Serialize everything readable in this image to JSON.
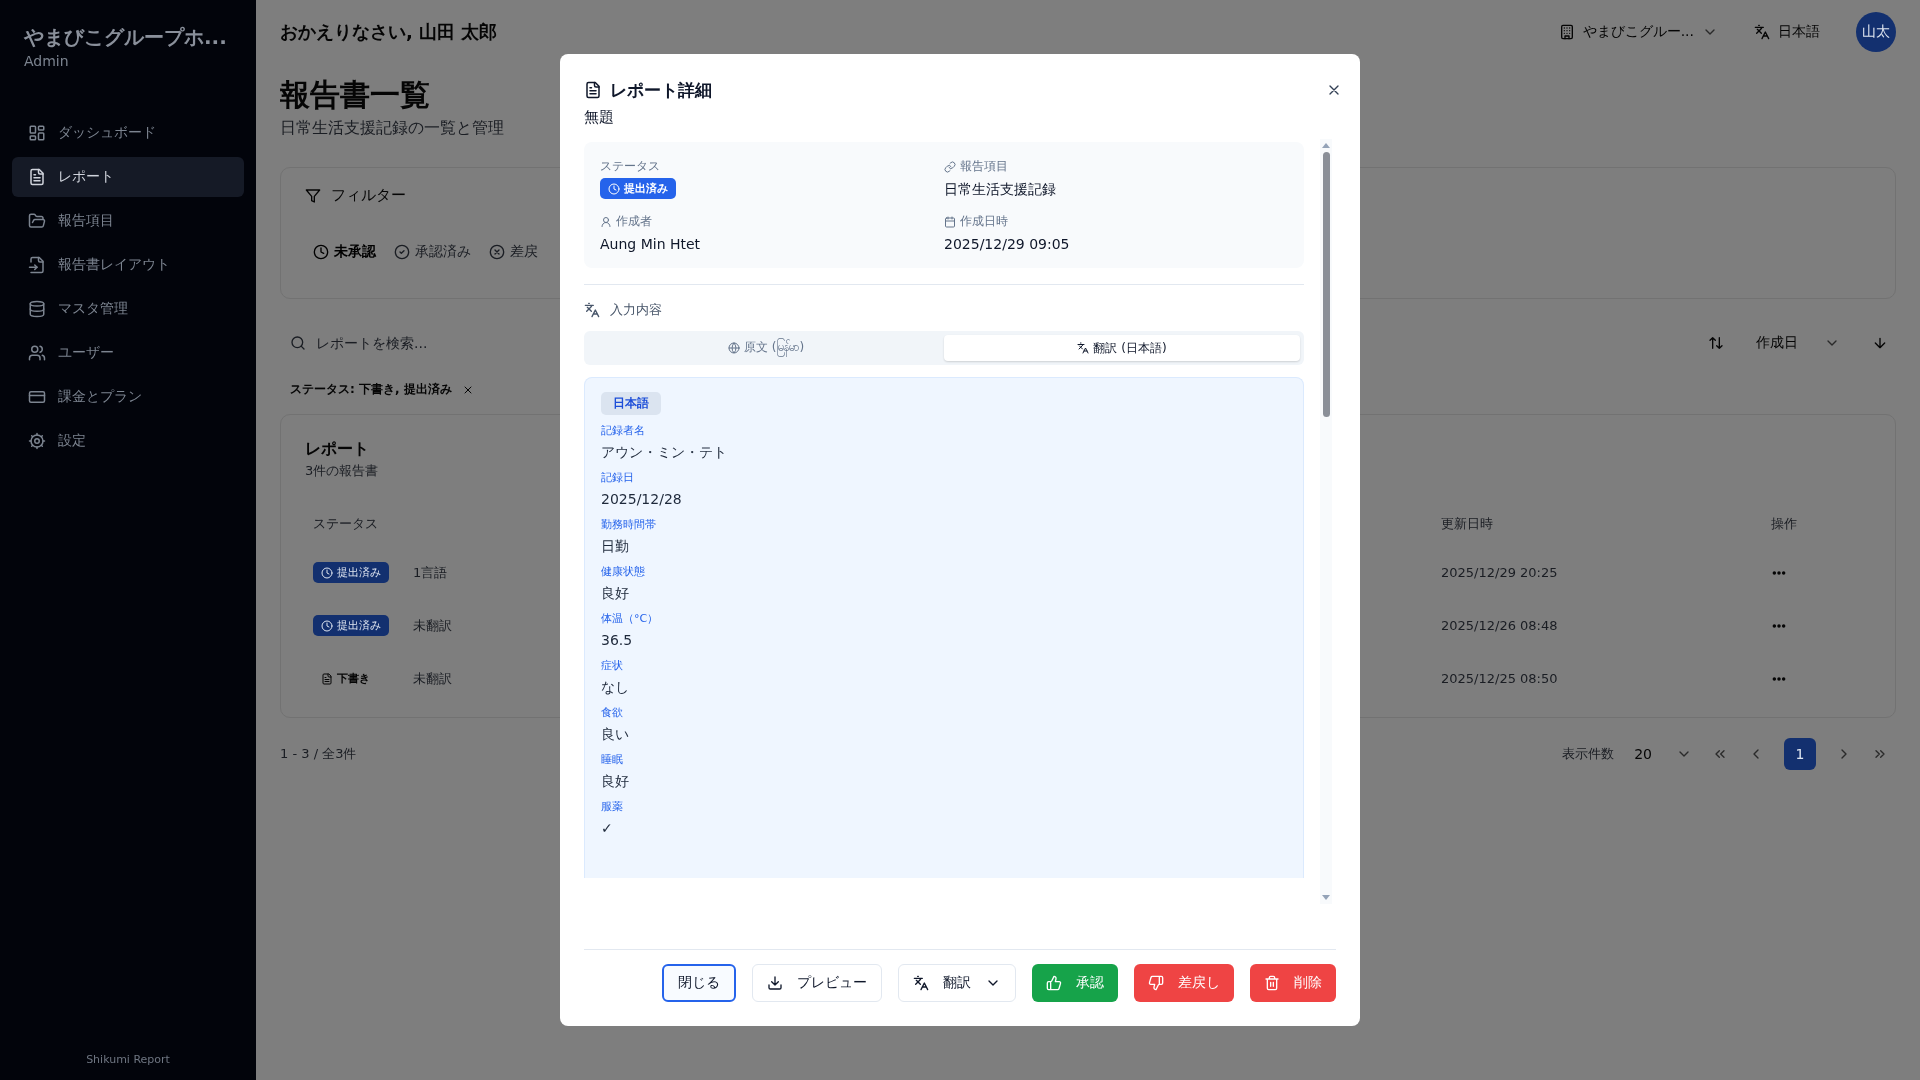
{
  "sidebar": {
    "brand": "やまびこグループホ...",
    "role": "Admin",
    "items": [
      {
        "label": "ダッシュボード",
        "selected": false
      },
      {
        "label": "レポート",
        "selected": true
      },
      {
        "label": "報告項目",
        "selected": false
      },
      {
        "label": "報告書レイアウト",
        "selected": false
      },
      {
        "label": "マスタ管理",
        "selected": false
      },
      {
        "label": "ユーザー",
        "selected": false
      },
      {
        "label": "課金とプラン",
        "selected": false
      },
      {
        "label": "設定",
        "selected": false
      }
    ],
    "footer": "Shikumi Report"
  },
  "header": {
    "greeting": "おかえりなさい, 山田 太郎",
    "organization": "やまびこグルー...",
    "language": "日本語",
    "avatar": "山太"
  },
  "page": {
    "title": "報告書一覧",
    "subtitle": "日常生活支援記録の一覧と管理"
  },
  "filter": {
    "title": "フィルター",
    "tabs": [
      {
        "label": "未承認",
        "selected": true
      },
      {
        "label": "承認済み",
        "selected": false
      },
      {
        "label": "差戻",
        "selected": false
      }
    ]
  },
  "search": {
    "placeholder": "レポートを検索...",
    "sort_field": "作成日"
  },
  "active_filter": "ステータス: 下書き, 提出済み",
  "reports": {
    "title": "レポート",
    "count": "3件の報告書",
    "columns": [
      "ステータス",
      "",
      "更新日時",
      "操作"
    ],
    "rows": [
      {
        "status": "提出済み",
        "kind": "submitted",
        "translation": "1言語",
        "updated": "2025/12/29 20:25"
      },
      {
        "status": "提出済み",
        "kind": "submitted",
        "translation": "未翻訳",
        "updated": "2025/12/26 08:48"
      },
      {
        "status": "下書き",
        "kind": "draft",
        "translation": "未翻訳",
        "updated": "2025/12/25 08:50"
      }
    ]
  },
  "pagination": {
    "range": "1 - 3 / 全3件",
    "per_page_label": "表示件数",
    "per_page": "20",
    "pages": [
      {
        "label": "1",
        "selected": true
      }
    ]
  },
  "modal": {
    "title": "レポート詳細",
    "subtitle": "無題",
    "info": [
      {
        "label": "ステータス",
        "kind": "badge",
        "value": "提出済み"
      },
      {
        "label": "報告項目",
        "kind": "text",
        "value": "日常生活支援記録"
      },
      {
        "label": "作成者",
        "kind": "text",
        "value": "Aung Min Htet"
      },
      {
        "label": "作成日時",
        "kind": "text",
        "value": "2025/12/29 09:05"
      }
    ],
    "content_title": "入力内容",
    "view_tabs": [
      {
        "label": "原文 (မြန်မာ)",
        "selected": false
      },
      {
        "label": "翻訳 (日本語)",
        "selected": true
      }
    ],
    "translation": {
      "language": "日本語",
      "fields": [
        {
          "label": "記録者名",
          "value": "アウン・ミン・テト"
        },
        {
          "label": "記録日",
          "value": "2025/12/28"
        },
        {
          "label": "勤務時間帯",
          "value": "日勤"
        },
        {
          "label": "健康状態",
          "value": "良好"
        },
        {
          "label": "体温（°C）",
          "value": "36.5"
        },
        {
          "label": "症状",
          "value": "なし"
        },
        {
          "label": "食欲",
          "value": "良い"
        },
        {
          "label": "睡眠",
          "value": "良好"
        },
        {
          "label": "服薬",
          "value": "✓"
        }
      ]
    },
    "buttons": [
      {
        "label": "閉じる",
        "kind": "outline",
        "focused": true
      },
      {
        "label": "プレビュー",
        "kind": "outline",
        "focused": false
      },
      {
        "label": "翻訳",
        "kind": "dropdown",
        "focused": false
      },
      {
        "label": "承認",
        "kind": "success",
        "focused": false
      },
      {
        "label": "差戻し",
        "kind": "danger",
        "focused": false
      },
      {
        "label": "削除",
        "kind": "danger",
        "focused": false
      }
    ]
  }
}
